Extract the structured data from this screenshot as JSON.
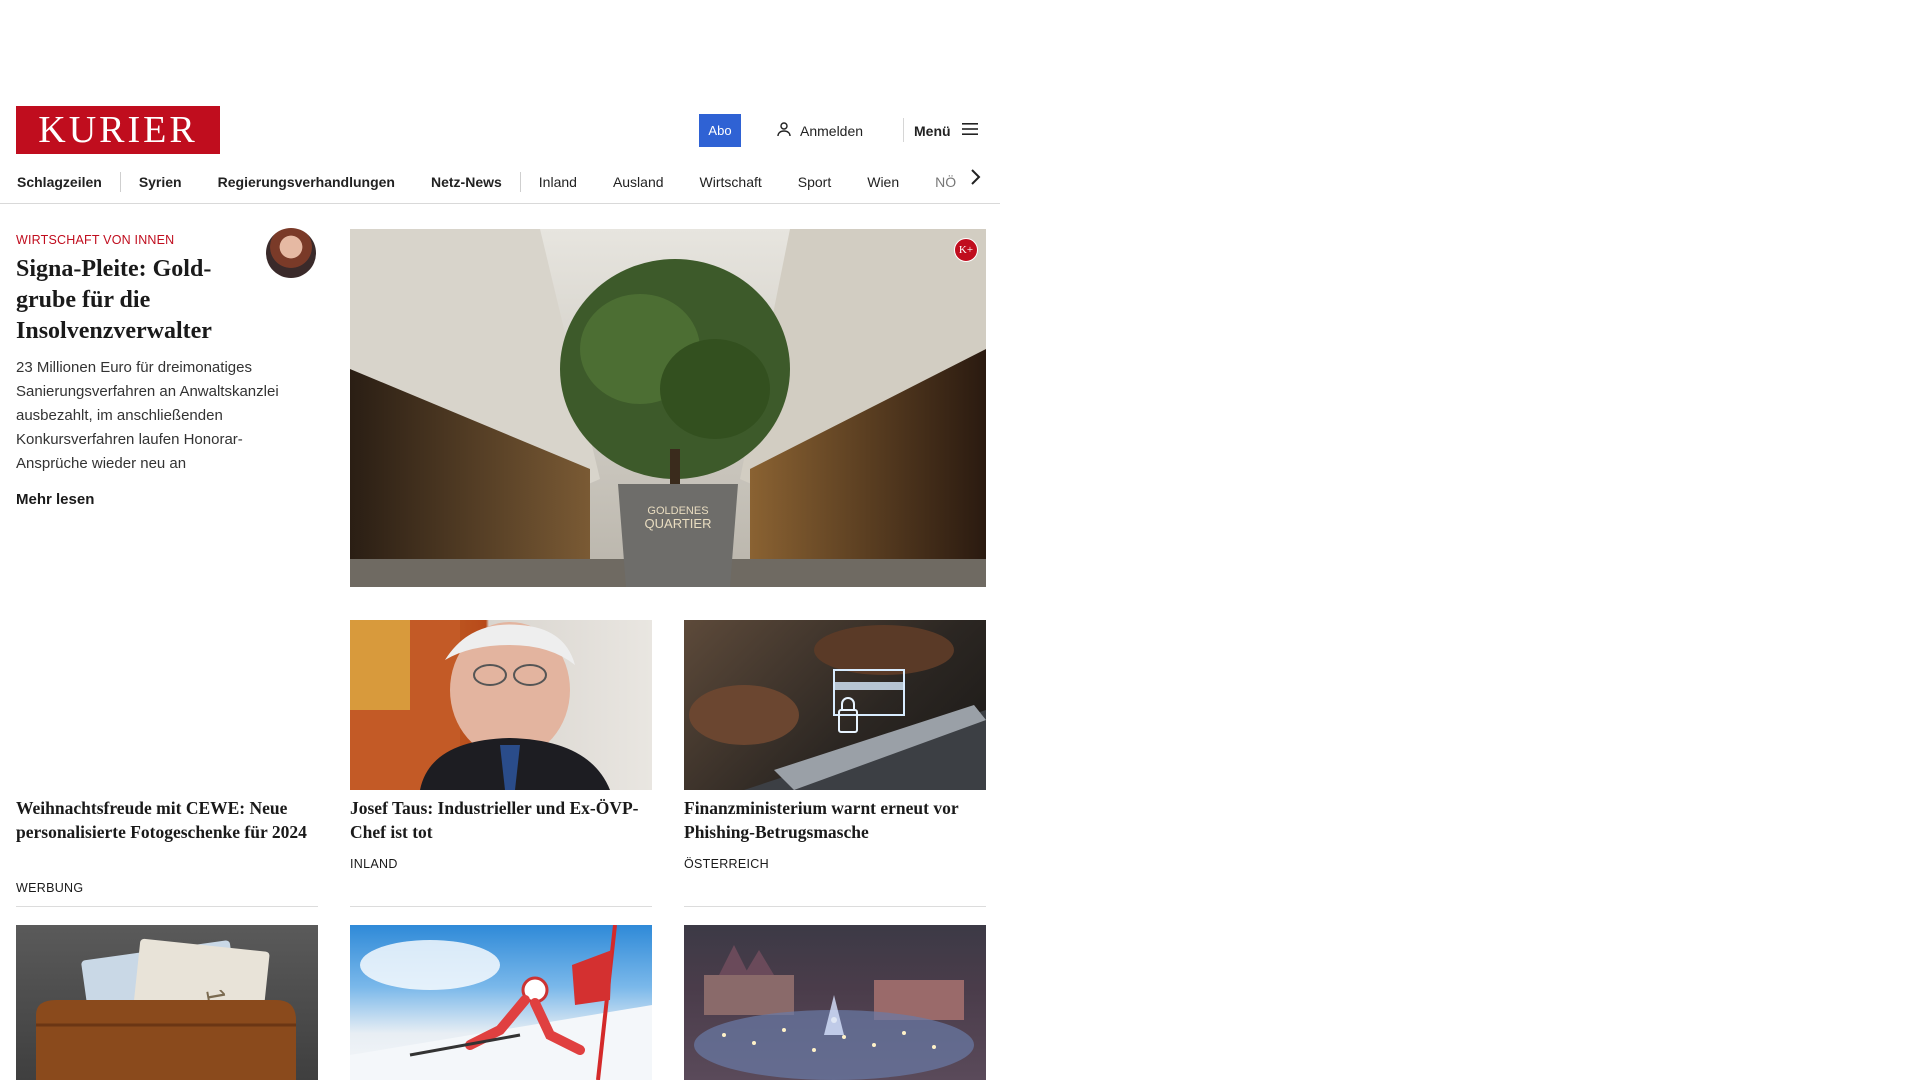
{
  "header": {
    "logo_text": "KURIER",
    "abo_label": "Abo",
    "login_label": "Anmelden",
    "menu_label": "Menü"
  },
  "nav": {
    "items": [
      {
        "label": "Schlagzeilen",
        "bold": true
      },
      {
        "label": "Syrien",
        "bold": true
      },
      {
        "label": "Regierungsverhandlungen",
        "bold": true
      },
      {
        "label": "Netz-News",
        "bold": true
      },
      {
        "label": "Inland",
        "bold": false
      },
      {
        "label": "Ausland",
        "bold": false
      },
      {
        "label": "Wirtschaft",
        "bold": false
      },
      {
        "label": "Sport",
        "bold": false
      },
      {
        "label": "Wien",
        "bold": false
      },
      {
        "label": "NÖ",
        "bold": false
      }
    ]
  },
  "lead": {
    "kicker": "WIRTSCHAFT VON INNEN",
    "title": "Signa-Pleite: Gold­grube für die Insolvenzverwalter",
    "text": "23 Millionen Euro für dreimonatiges Sanierungsverfahren an Anwaltskanzlei ausbezahlt, im anschließenden Konkursverfahren laufen Honorar-Ansprüche wieder neu an",
    "more_label": "Mehr lesen",
    "badge": "K+",
    "image_sign_line1": "GOLDENES",
    "image_sign_line2": "QUARTIER"
  },
  "cards": [
    {
      "title": "Weihnachtsfreude mit CEWE: Neue personalisierte Fotogeschenke für 2024",
      "tag": "WERBUNG"
    },
    {
      "title": "Josef Taus: Industrieller und Ex-ÖVP-Chef ist tot",
      "tag": "INLAND"
    },
    {
      "title": "Finanzministerium warnt erneut vor Phishing-Betrugsmasche",
      "tag": "ÖSTERREICH"
    }
  ],
  "colors": {
    "brand_red": "#c00d1e",
    "abo_blue": "#2f62d4"
  }
}
